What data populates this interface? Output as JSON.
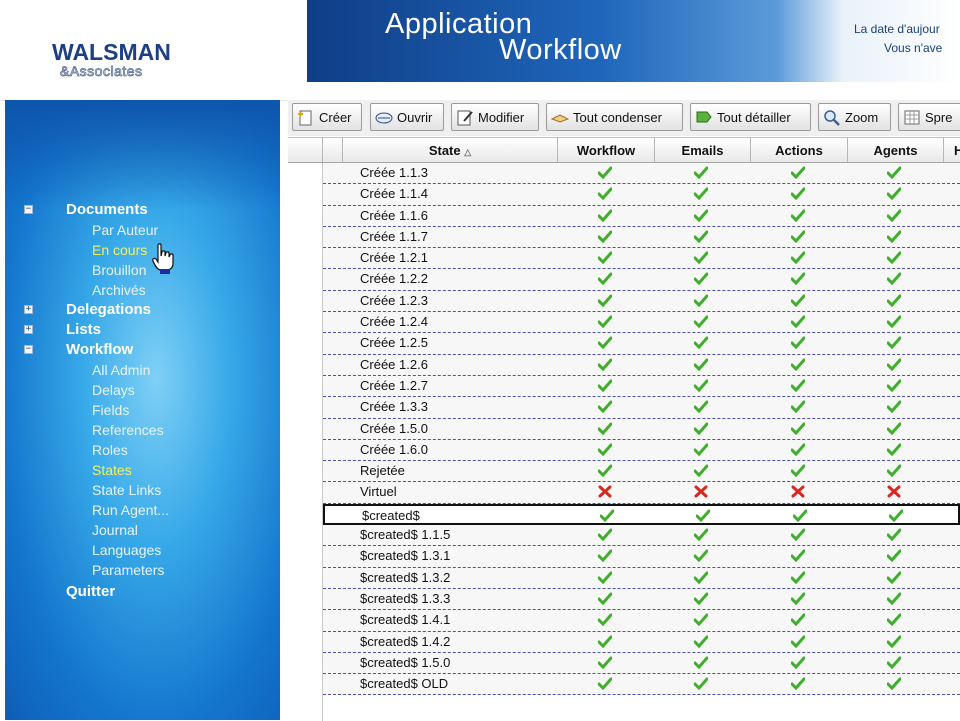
{
  "colors": {
    "accent": "#1476cd",
    "active_menu": "#f6f05a",
    "check": "#3fae2a",
    "cross": "#d8281c"
  },
  "logo": {
    "text_main": "WALSMAN",
    "text_sub": "&Associates"
  },
  "banner": {
    "title_line1": "Application",
    "title_line2": "Workflow",
    "info_line1": "La date d'aujour",
    "info_line2": "Vous n'ave"
  },
  "sidebar": {
    "sections": [
      {
        "label": "Documents",
        "expander": "−",
        "items": [
          "Par Auteur",
          "En cours",
          "Brouillon",
          "Archivés"
        ],
        "active": "En cours"
      },
      {
        "label": "Delegations",
        "expander": "+"
      },
      {
        "label": "Lists",
        "expander": "+"
      },
      {
        "label": "Workflow",
        "expander": "−",
        "items": [
          "All Admin",
          "Delays",
          "Fields",
          "References",
          "Roles",
          "States",
          "State Links",
          "Run Agent...",
          "Journal",
          "Languages",
          "Parameters"
        ],
        "active": "States"
      },
      {
        "label": "Quitter"
      }
    ]
  },
  "toolbar": {
    "buttons": [
      {
        "label": "Créer",
        "icon": "create-icon"
      },
      {
        "label": "Ouvrir",
        "icon": "open-icon"
      },
      {
        "label": "Modifier",
        "icon": "edit-icon"
      },
      {
        "label": "Tout condenser",
        "icon": "collapse-icon"
      },
      {
        "label": "Tout détailler",
        "icon": "expand-icon"
      },
      {
        "label": "Zoom",
        "icon": "zoom-icon"
      },
      {
        "label": "Spre",
        "icon": "spreadsheet-icon"
      }
    ]
  },
  "grid": {
    "columns": [
      {
        "label": "State",
        "sorted": "asc"
      },
      {
        "label": "Workflow"
      },
      {
        "label": "Emails"
      },
      {
        "label": "Actions"
      },
      {
        "label": "Agents"
      },
      {
        "label": "H"
      }
    ],
    "rows": [
      {
        "state": "Créée 1.1.3",
        "flags": [
          true,
          true,
          true,
          true
        ]
      },
      {
        "state": "Créée 1.1.4",
        "flags": [
          true,
          true,
          true,
          true
        ]
      },
      {
        "state": "Créée 1.1.6",
        "flags": [
          true,
          true,
          true,
          true
        ]
      },
      {
        "state": "Créée 1.1.7",
        "flags": [
          true,
          true,
          true,
          true
        ]
      },
      {
        "state": "Créée 1.2.1",
        "flags": [
          true,
          true,
          true,
          true
        ]
      },
      {
        "state": "Créée 1.2.2",
        "flags": [
          true,
          true,
          true,
          true
        ]
      },
      {
        "state": "Créée 1.2.3",
        "flags": [
          true,
          true,
          true,
          true
        ]
      },
      {
        "state": "Créée 1.2.4",
        "flags": [
          true,
          true,
          true,
          true
        ]
      },
      {
        "state": "Créée 1.2.5",
        "flags": [
          true,
          true,
          true,
          true
        ]
      },
      {
        "state": "Créée 1.2.6",
        "flags": [
          true,
          true,
          true,
          true
        ]
      },
      {
        "state": "Créée 1.2.7",
        "flags": [
          true,
          true,
          true,
          true
        ]
      },
      {
        "state": "Créée 1.3.3",
        "flags": [
          true,
          true,
          true,
          true
        ]
      },
      {
        "state": "Créée 1.5.0",
        "flags": [
          true,
          true,
          true,
          true
        ]
      },
      {
        "state": "Créée 1.6.0",
        "flags": [
          true,
          true,
          true,
          true
        ]
      },
      {
        "state": "Rejetée",
        "flags": [
          true,
          true,
          true,
          true
        ]
      },
      {
        "state": "Virtuel",
        "flags": [
          false,
          false,
          false,
          false
        ]
      },
      {
        "state": "$created$",
        "flags": [
          true,
          true,
          true,
          true
        ],
        "selected": true
      },
      {
        "state": "$created$ 1.1.5",
        "flags": [
          true,
          true,
          true,
          true
        ]
      },
      {
        "state": "$created$ 1.3.1",
        "flags": [
          true,
          true,
          true,
          true
        ]
      },
      {
        "state": "$created$ 1.3.2",
        "flags": [
          true,
          true,
          true,
          true
        ]
      },
      {
        "state": "$created$ 1.3.3",
        "flags": [
          true,
          true,
          true,
          true
        ]
      },
      {
        "state": "$created$ 1.4.1",
        "flags": [
          true,
          true,
          true,
          true
        ]
      },
      {
        "state": "$created$ 1.4.2",
        "flags": [
          true,
          true,
          true,
          true
        ]
      },
      {
        "state": "$created$ 1.5.0",
        "flags": [
          true,
          true,
          true,
          true
        ]
      },
      {
        "state": "$created$ OLD",
        "flags": [
          true,
          true,
          true,
          true
        ]
      }
    ]
  }
}
